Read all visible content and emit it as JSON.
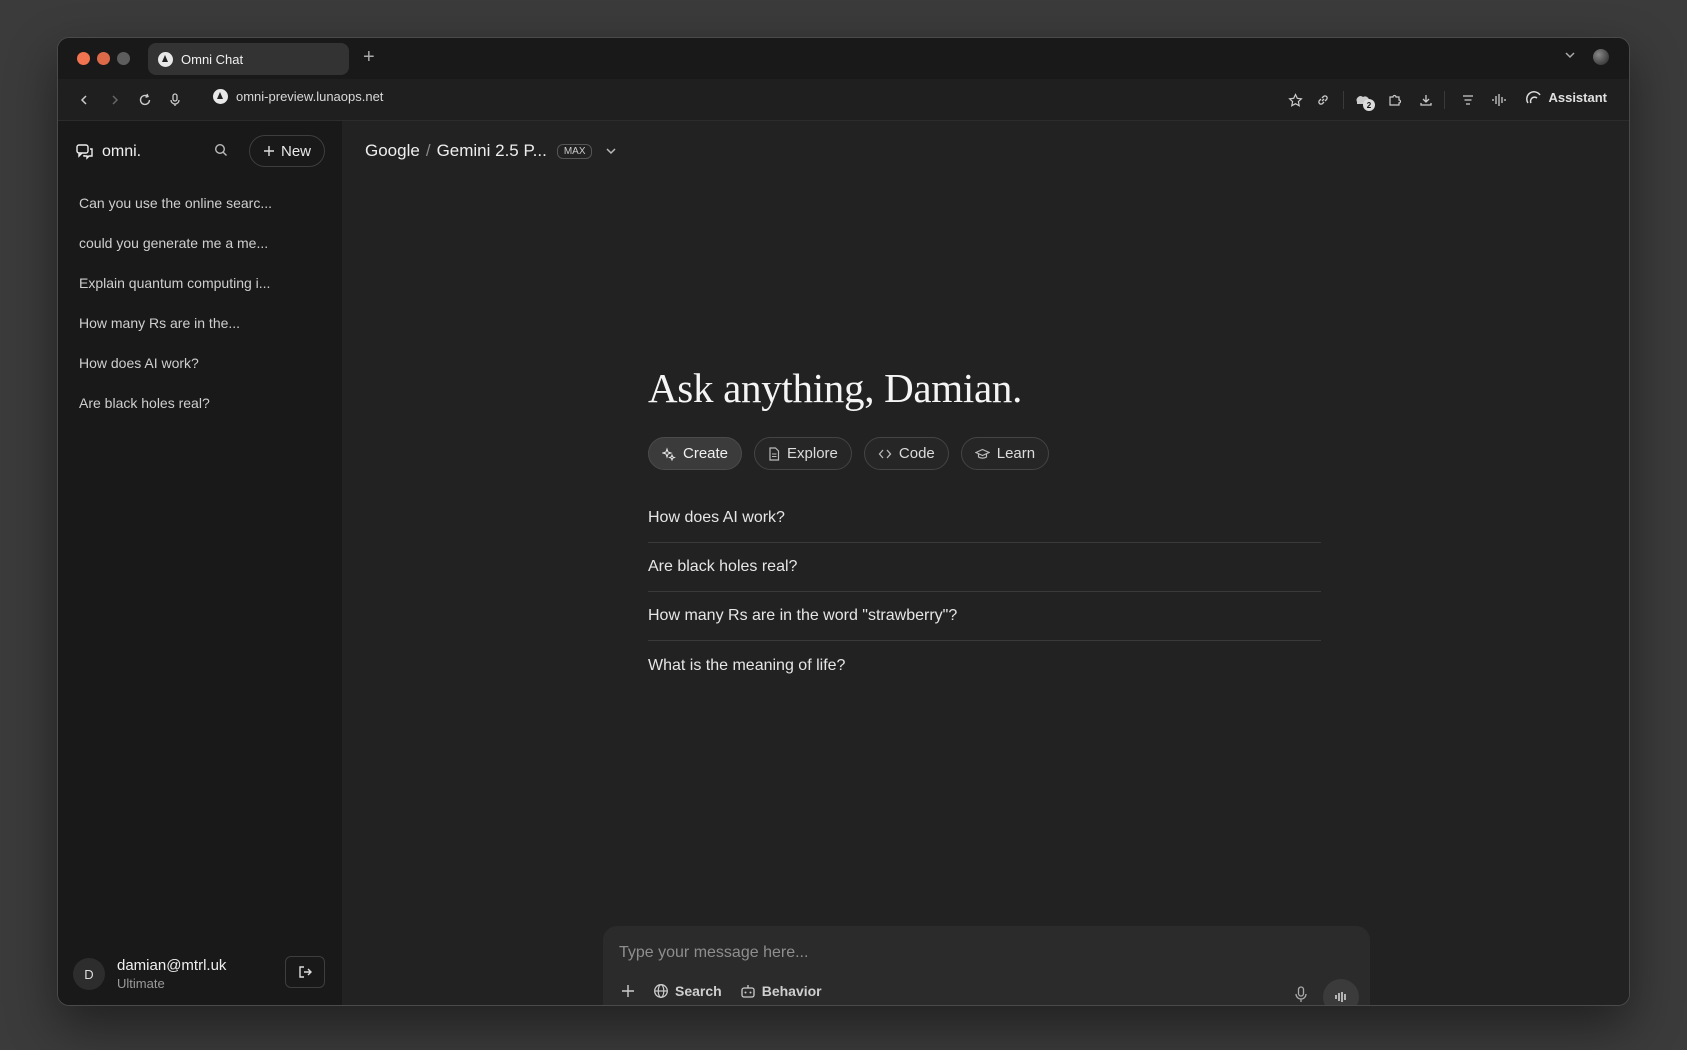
{
  "browser": {
    "tab_title": "Omni Chat",
    "url": "omni-preview.lunaops.net",
    "extensions_badge": "2",
    "assistant_label": "Assistant"
  },
  "sidebar": {
    "brand": "omni.",
    "new_label": "New",
    "history": [
      {
        "label": "Can you use the online searc..."
      },
      {
        "label": "could you generate me a me..."
      },
      {
        "label": "Explain quantum computing i..."
      },
      {
        "label": "How many Rs are in the..."
      },
      {
        "label": "How does AI work?"
      },
      {
        "label": "Are black holes real?"
      }
    ],
    "user": {
      "avatar_initial": "D",
      "email": "damian@mtrl.uk",
      "plan": "Ultimate"
    }
  },
  "main": {
    "model_provider": "Google",
    "model_separator": "/",
    "model_name": "Gemini 2.5 P...",
    "model_badge": "MAX",
    "greeting": "Ask anything, Damian.",
    "chips": [
      {
        "label": "Create",
        "icon": "sparkles-icon",
        "active": true
      },
      {
        "label": "Explore",
        "icon": "document-icon",
        "active": false
      },
      {
        "label": "Code",
        "icon": "code-icon",
        "active": false
      },
      {
        "label": "Learn",
        "icon": "graduation-cap-icon",
        "active": false
      }
    ],
    "suggestions": [
      {
        "label": "How does AI work?"
      },
      {
        "label": "Are black holes real?"
      },
      {
        "label": "How many Rs are in the word \"strawberry\"?"
      },
      {
        "label": "What is the meaning of life?"
      }
    ]
  },
  "composer": {
    "placeholder": "Type your message here...",
    "search_label": "Search",
    "behavior_label": "Behavior"
  },
  "colors": {
    "window_bg": "#1f1f1f",
    "sidebar_bg": "#191919",
    "main_bg": "#222222",
    "traffic_red": "#f2734f"
  }
}
